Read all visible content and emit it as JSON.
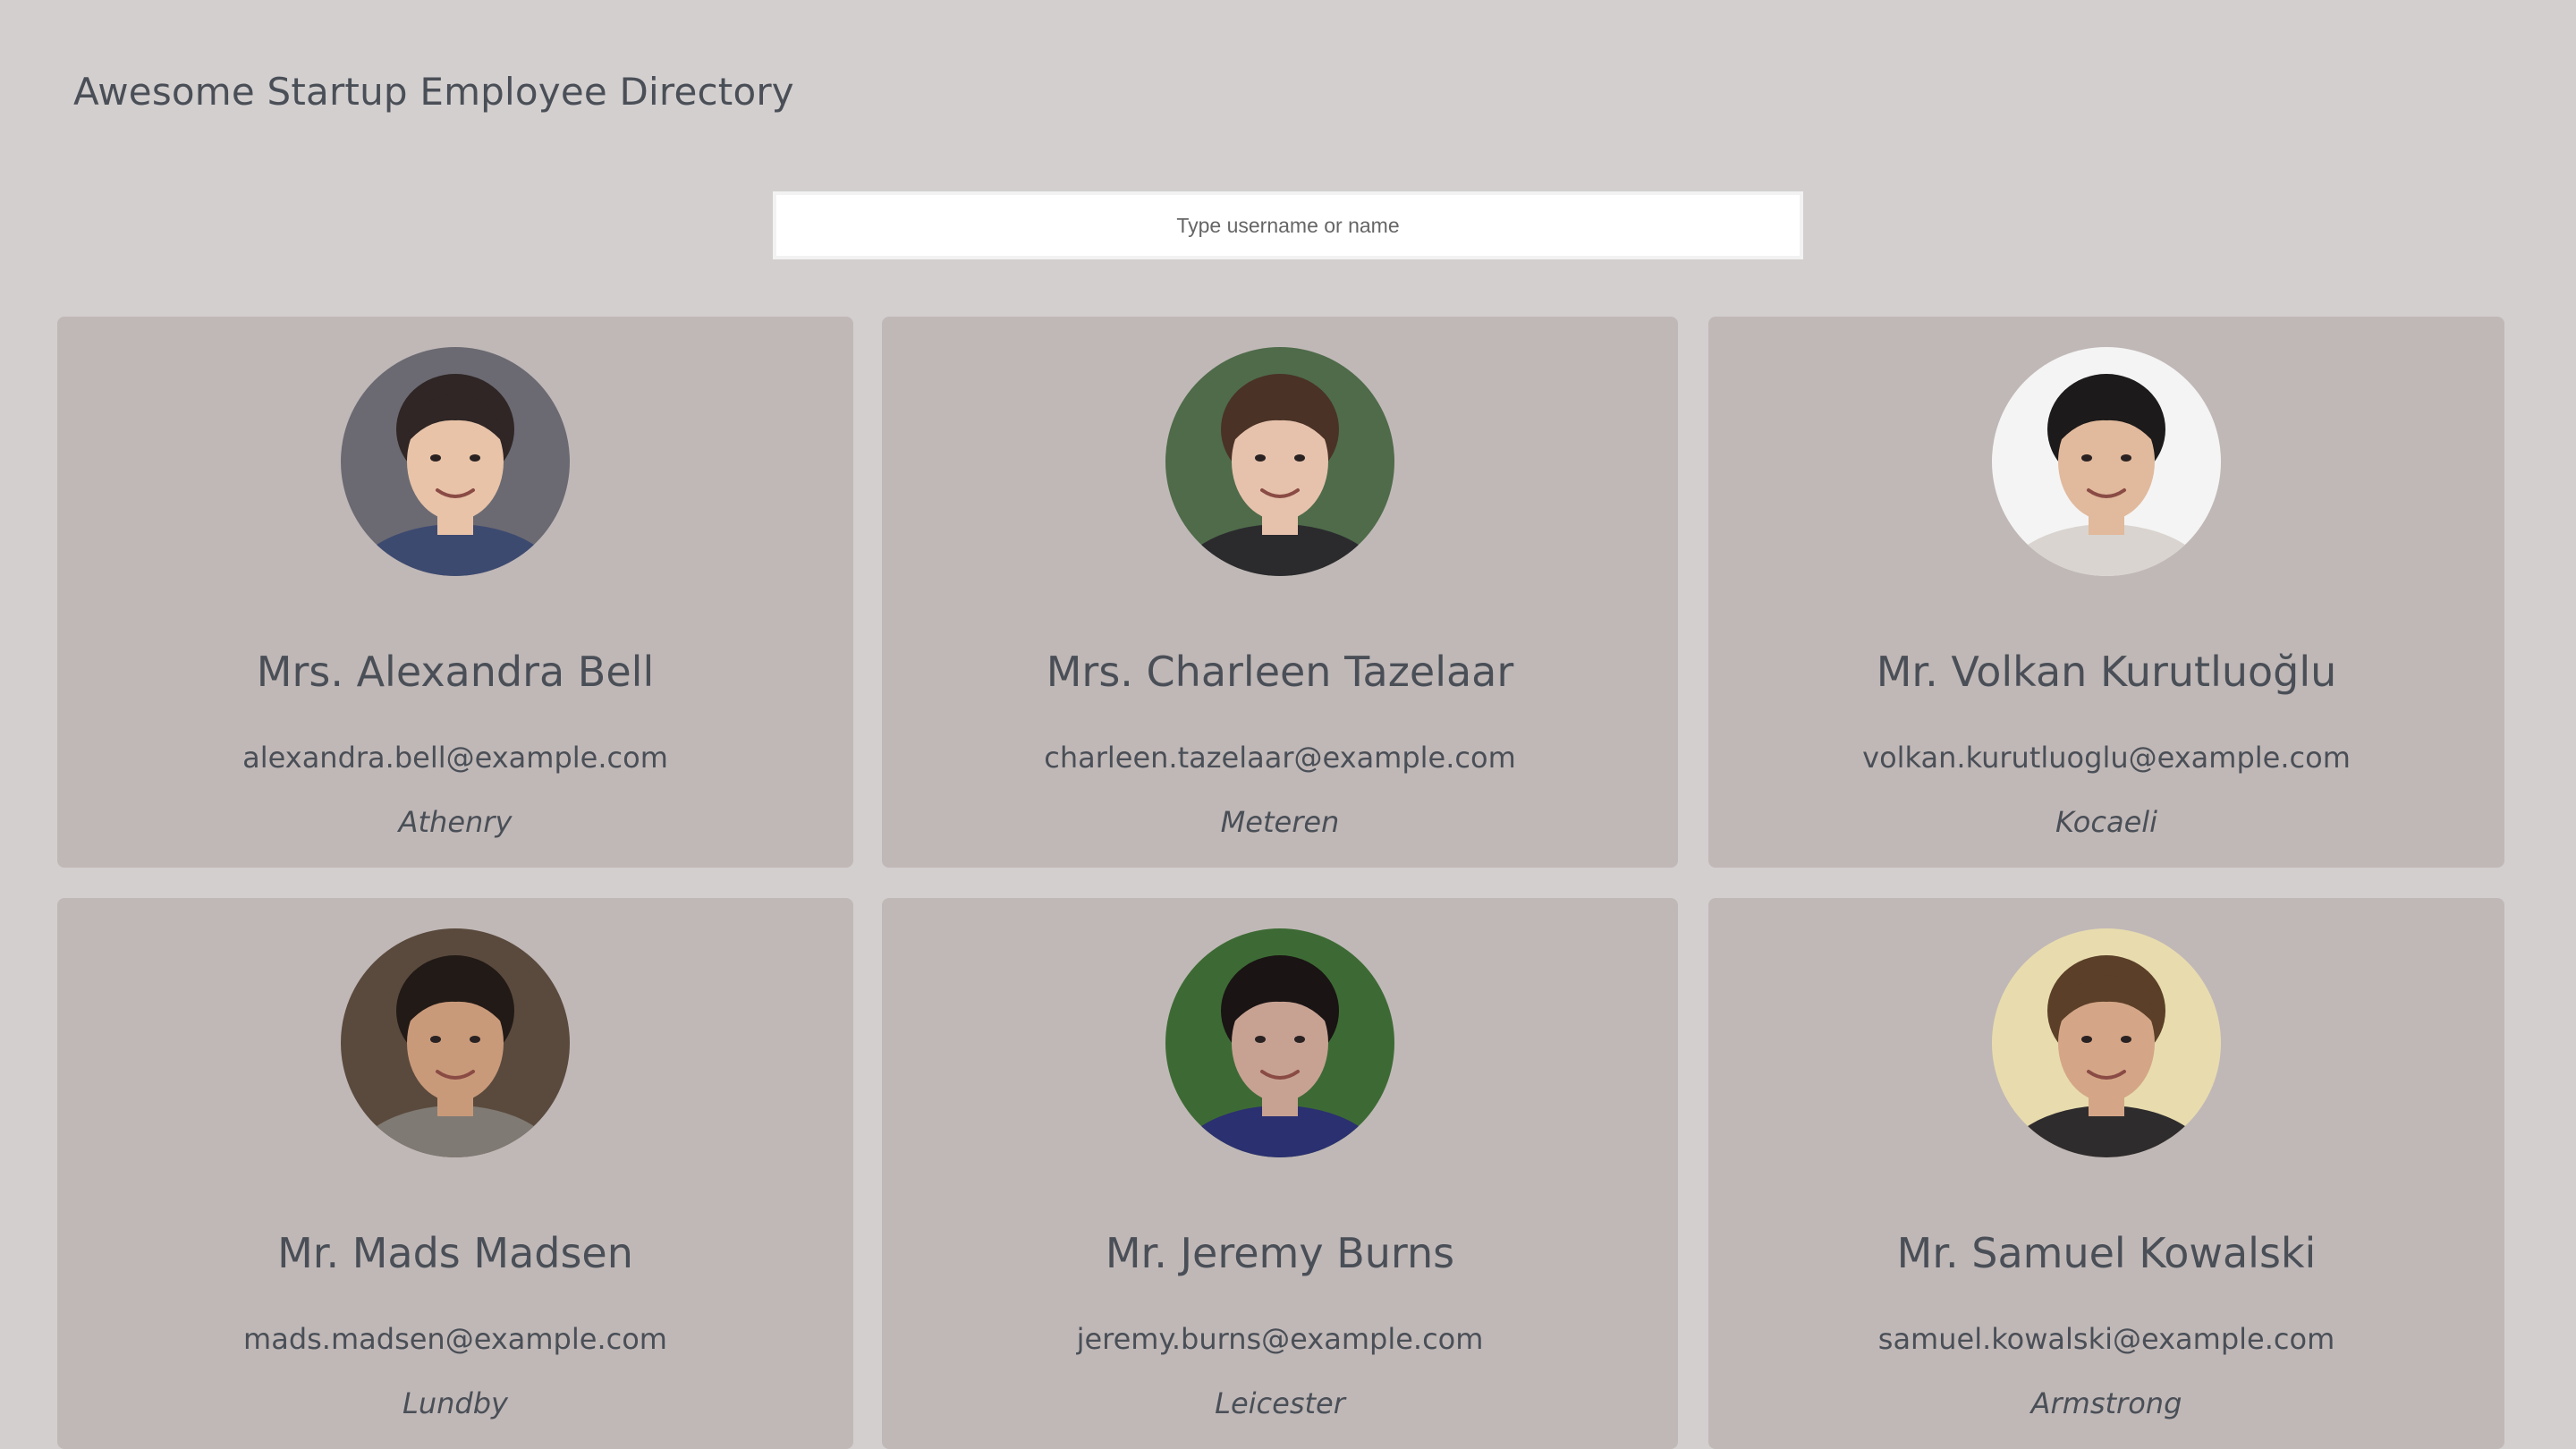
{
  "header": {
    "title": "Awesome Startup Employee Directory"
  },
  "search": {
    "placeholder": "Type username or name",
    "value": ""
  },
  "employees": [
    {
      "name": "Mrs. Alexandra Bell",
      "email": "alexandra.bell@example.com",
      "city": "Athenry",
      "avatar_bg": "#6b6a72",
      "skin": "#e8c3a8",
      "hair": "#2f2625",
      "shirt": "#3d4a70"
    },
    {
      "name": "Mrs. Charleen Tazelaar",
      "email": "charleen.tazelaar@example.com",
      "city": "Meteren",
      "avatar_bg": "#4f6b4a",
      "skin": "#e6c2ac",
      "hair": "#4a3226",
      "shirt": "#2b2b2e"
    },
    {
      "name": "Mr. Volkan Kurutluoğlu",
      "email": "volkan.kurutluoglu@example.com",
      "city": "Kocaeli",
      "avatar_bg": "#f4f4f4",
      "skin": "#e1b99c",
      "hair": "#1c1a1a",
      "shirt": "#d9d4cf"
    },
    {
      "name": "Mr. Mads Madsen",
      "email": "mads.madsen@example.com",
      "city": "Lundby",
      "avatar_bg": "#5a4a3d",
      "skin": "#c99a7a",
      "hair": "#221a16",
      "shirt": "#7f7a73"
    },
    {
      "name": "Mr. Jeremy Burns",
      "email": "jeremy.burns@example.com",
      "city": "Leicester",
      "avatar_bg": "#3d6a34",
      "skin": "#c7a293",
      "hair": "#1a1414",
      "shirt": "#2b3070"
    },
    {
      "name": "Mr. Samuel Kowalski",
      "email": "samuel.kowalski@example.com",
      "city": "Armstrong",
      "avatar_bg": "#e8dcae",
      "skin": "#d4a687",
      "hair": "#5b3f28",
      "shirt": "#2f2c2e"
    }
  ]
}
